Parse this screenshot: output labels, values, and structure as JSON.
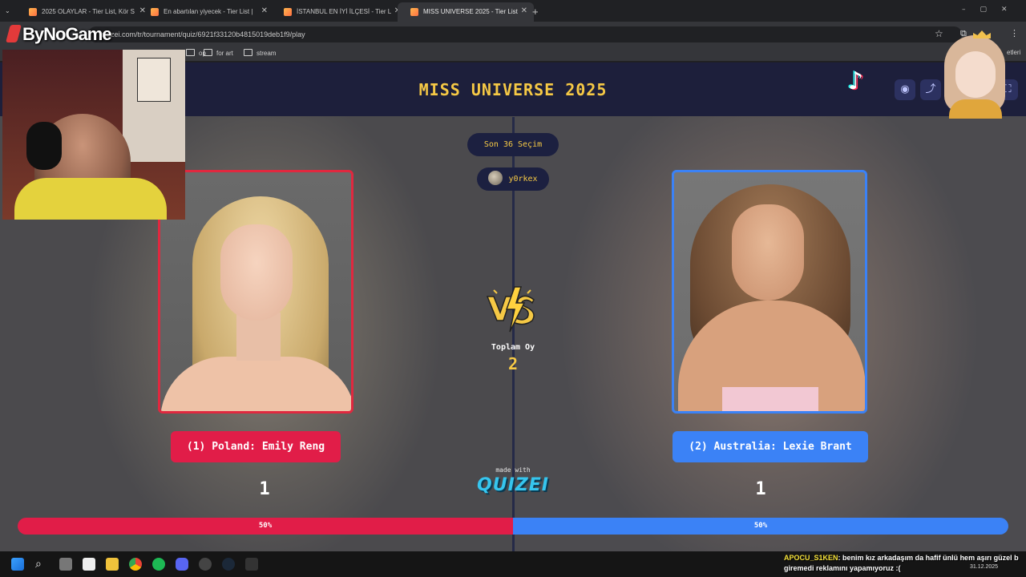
{
  "browser": {
    "tabs": [
      {
        "title": "2025 OLAYLAR - Tier List, Kör S"
      },
      {
        "title": "En abartılan yiyecek - Tier List |"
      },
      {
        "title": "İSTANBUL EN İYİ İLÇESİ - Tier L"
      },
      {
        "title": "MISS UNIVERSE 2025 - Tier List"
      }
    ],
    "url": "quizei.com/tr/tournament/quiz/6921f33120b4815019deb1f9/play",
    "bookmarks": [
      "op",
      "for art",
      "stream"
    ],
    "bookmarks_right": "etleri"
  },
  "overlay": {
    "brand": "ByNoGame"
  },
  "quiz": {
    "title": "MISS UNIVERSE 2025",
    "round_label": "Son 36 Seçim",
    "user": "y0rkex",
    "left": {
      "label": "(1) Poland: Emily Reng",
      "score": "1",
      "percent": "50%",
      "color": "#e11d48",
      "fraction": 0.5
    },
    "right": {
      "label": "(2) Australia: Lexie Brant",
      "score": "1",
      "percent": "50%",
      "color": "#3b82f6",
      "fraction": 0.5
    },
    "vs_text": "VS",
    "total_votes_label": "Toplam Oy",
    "total_votes": "2",
    "made_with": "made with",
    "logo": "QUIZEI"
  },
  "stream_chat": {
    "user": "APOCU_S1KEN",
    "message": ": benim kız arkadaşım da hafif ünlü hem aşırı güzel b",
    "message2": "giremedi reklamını yapamıyoruz :("
  },
  "taskbar": {
    "date": "31.12.2025"
  },
  "colors": {
    "accent": "#f6c945",
    "header": "#1d1f3b",
    "red": "#e11d48",
    "blue": "#3b82f6"
  }
}
